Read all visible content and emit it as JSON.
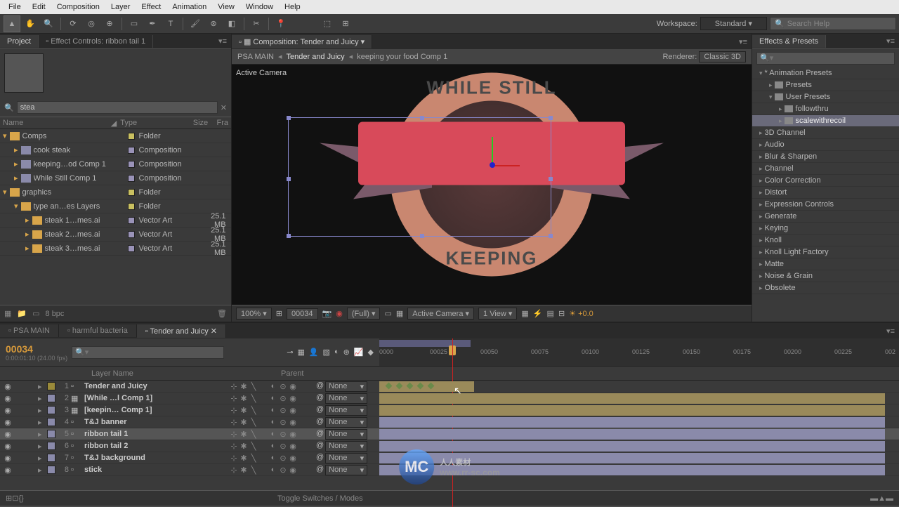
{
  "menu": [
    "File",
    "Edit",
    "Composition",
    "Layer",
    "Effect",
    "Animation",
    "View",
    "Window",
    "Help"
  ],
  "workspace": {
    "label": "Workspace:",
    "value": "Standard"
  },
  "searchHelp": {
    "placeholder": "Search Help"
  },
  "projectPanel": {
    "tabs": {
      "project": "Project",
      "fx": "Effect Controls: ribbon tail 1"
    },
    "search": "stea",
    "headers": {
      "name": "Name",
      "type": "Type",
      "size": "Size",
      "fr": "Fra"
    },
    "items": [
      {
        "level": 0,
        "kind": "folder",
        "name": "Comps",
        "type": "Folder",
        "label": "yellow"
      },
      {
        "level": 1,
        "kind": "comp",
        "name": "cook steak",
        "type": "Composition",
        "label": "lav"
      },
      {
        "level": 1,
        "kind": "comp",
        "name": "keeping…od Comp 1",
        "type": "Composition",
        "label": "lav"
      },
      {
        "level": 1,
        "kind": "comp",
        "name": "While Still Comp 1",
        "type": "Composition",
        "label": "lav"
      },
      {
        "level": 0,
        "kind": "folder",
        "name": "graphics",
        "type": "Folder",
        "label": "yellow"
      },
      {
        "level": 1,
        "kind": "folder",
        "name": "type an…es Layers",
        "type": "Folder",
        "label": "yellow"
      },
      {
        "level": 2,
        "kind": "vec",
        "name": "steak 1…mes.ai",
        "type": "Vector Art",
        "size": "25.1 MB",
        "label": "lav"
      },
      {
        "level": 2,
        "kind": "vec",
        "name": "steak 2…mes.ai",
        "type": "Vector Art",
        "size": "25.1 MB",
        "label": "lav"
      },
      {
        "level": 2,
        "kind": "vec",
        "name": "steak 3…mes.ai",
        "type": "Vector Art",
        "size": "25.1 MB",
        "label": "lav"
      }
    ],
    "footer": {
      "bpc": "8 bpc"
    }
  },
  "compPanel": {
    "tabLabel": "Composition: Tender and Juicy",
    "breadcrumb": [
      "PSA MAIN",
      "Tender and Juicy",
      "keeping your food Comp 1"
    ],
    "rendererLabel": "Renderer:",
    "renderer": "Classic 3D",
    "activeCam": "Active Camera",
    "badge": {
      "top": "WHILE STILL",
      "bottom": "KEEPING"
    },
    "footer": {
      "zoom": "100%",
      "frame": "00034",
      "res": "(Full)",
      "view": "Active Camera",
      "views": "1 View",
      "exposure": "+0.0"
    }
  },
  "effectsPanel": {
    "title": "Effects & Presets",
    "search": "",
    "items": [
      {
        "l": 0,
        "t": "* Animation Presets",
        "exp": true
      },
      {
        "l": 1,
        "t": "Presets",
        "folder": true
      },
      {
        "l": 1,
        "t": "User Presets",
        "folder": true,
        "exp": true
      },
      {
        "l": 2,
        "t": "followthru",
        "preset": true
      },
      {
        "l": 2,
        "t": "scalewithrecoil",
        "preset": true,
        "sel": true
      },
      {
        "l": 0,
        "t": "3D Channel"
      },
      {
        "l": 0,
        "t": "Audio"
      },
      {
        "l": 0,
        "t": "Blur & Sharpen"
      },
      {
        "l": 0,
        "t": "Channel"
      },
      {
        "l": 0,
        "t": "Color Correction"
      },
      {
        "l": 0,
        "t": "Distort"
      },
      {
        "l": 0,
        "t": "Expression Controls"
      },
      {
        "l": 0,
        "t": "Generate"
      },
      {
        "l": 0,
        "t": "Keying"
      },
      {
        "l": 0,
        "t": "Knoll"
      },
      {
        "l": 0,
        "t": "Knoll Light Factory"
      },
      {
        "l": 0,
        "t": "Matte"
      },
      {
        "l": 0,
        "t": "Noise & Grain"
      },
      {
        "l": 0,
        "t": "Obsolete"
      }
    ]
  },
  "timeline": {
    "tabs": [
      "PSA MAIN",
      "harmful bacteria",
      "Tender and Juicy"
    ],
    "activeTab": 2,
    "timecode": "00034",
    "timecodeSub": "0:00:01:10 (24.00 fps)",
    "ruler": [
      "0000",
      "00025",
      "00050",
      "00075",
      "00100",
      "00125",
      "00150",
      "00175",
      "00200",
      "00225",
      "002"
    ],
    "colLayerName": "Layer Name",
    "colParent": "Parent",
    "parentNone": "None",
    "toggleLabel": "Toggle Switches / Modes",
    "layers": [
      {
        "n": 1,
        "name": "Tender and Juicy",
        "label": "yel",
        "bar": "yel",
        "start": 0,
        "end": 135,
        "kf": true
      },
      {
        "n": 2,
        "name": "[While …l Comp 1]",
        "label": "lav",
        "bar": "yel",
        "start": 0,
        "end": 720,
        "pre": true
      },
      {
        "n": 3,
        "name": "[keepin… Comp 1]",
        "label": "lav",
        "bar": "yel",
        "start": 0,
        "end": 720,
        "pre": true
      },
      {
        "n": 4,
        "name": "T&J banner",
        "label": "lav",
        "bar": "lav",
        "start": 0,
        "end": 720
      },
      {
        "n": 5,
        "name": "ribbon tail 1",
        "label": "lav",
        "bar": "lav",
        "start": 0,
        "end": 720,
        "sel": true
      },
      {
        "n": 6,
        "name": "ribbon tail 2",
        "label": "lav",
        "bar": "lav",
        "start": 0,
        "end": 720
      },
      {
        "n": 7,
        "name": "T&J background",
        "label": "lav",
        "bar": "lav",
        "start": 0,
        "end": 720
      },
      {
        "n": 8,
        "name": "stick",
        "label": "lav",
        "bar": "lav",
        "start": 0,
        "end": 720
      }
    ]
  },
  "watermark": {
    "text": "人人素材",
    "url": "www.rr-sc.com"
  }
}
